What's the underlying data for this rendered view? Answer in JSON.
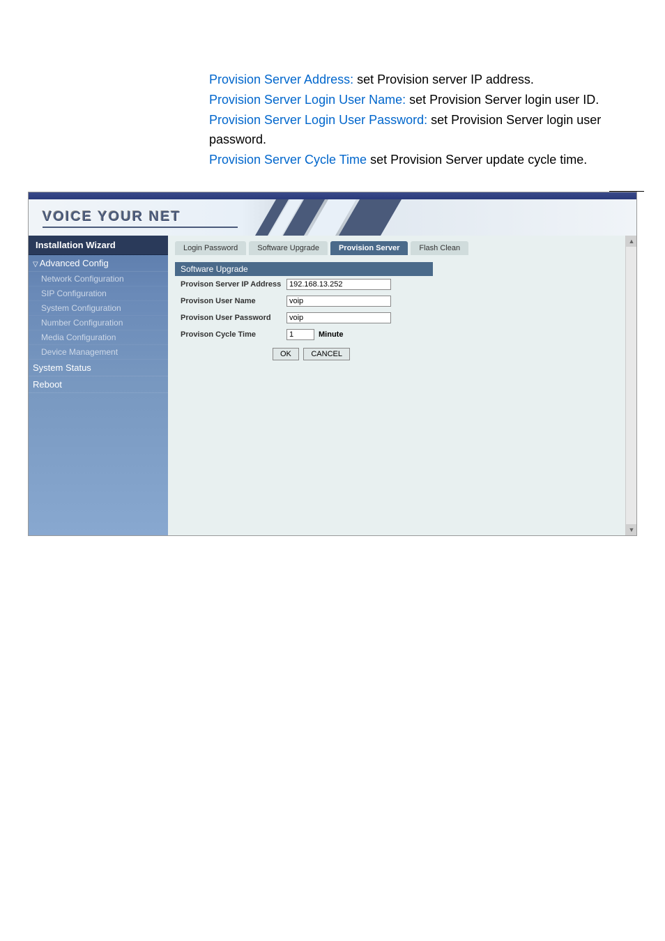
{
  "doc": {
    "p1_label": "Provision Server Address:",
    "p1_text": " set Provision server IP address.",
    "p2_label": "Provision Server Login User Name:",
    "p2_text": " set Provision Server login user ID.",
    "p3_label": "Provision Server Login User Password:",
    "p3_text": " set Provision Server login user password.",
    "p4_label": "Provision Server Cycle Time",
    "p4_text": "  set Provision Server update cycle time."
  },
  "banner": "VOICE YOUR NET",
  "sidebar": {
    "installation": "Installation Wizard",
    "advanced": "Advanced Config",
    "items": {
      "network": "Network Configuration",
      "sip": "SIP Configuration",
      "system": "System Configuration",
      "number": "Number Configuration",
      "media": "Media Configuration",
      "device": "Device Management"
    },
    "status": "System Status",
    "reboot": "Reboot"
  },
  "tabs": {
    "login": "Login Password",
    "software": "Software Upgrade",
    "provision": "Provision Server",
    "flash": "Flash Clean"
  },
  "panel": {
    "header": "Software Upgrade",
    "rows": {
      "ip_label": "Provison Server IP Address",
      "ip_value": "192.168.13.252",
      "user_label": "Provison User Name",
      "user_value": "voip",
      "pass_label": "Provison User Password",
      "pass_value": "voip",
      "cycle_label": "Provison Cycle Time",
      "cycle_value": "1",
      "cycle_unit": "Minute"
    },
    "buttons": {
      "ok": "OK",
      "cancel": "CANCEL"
    }
  }
}
